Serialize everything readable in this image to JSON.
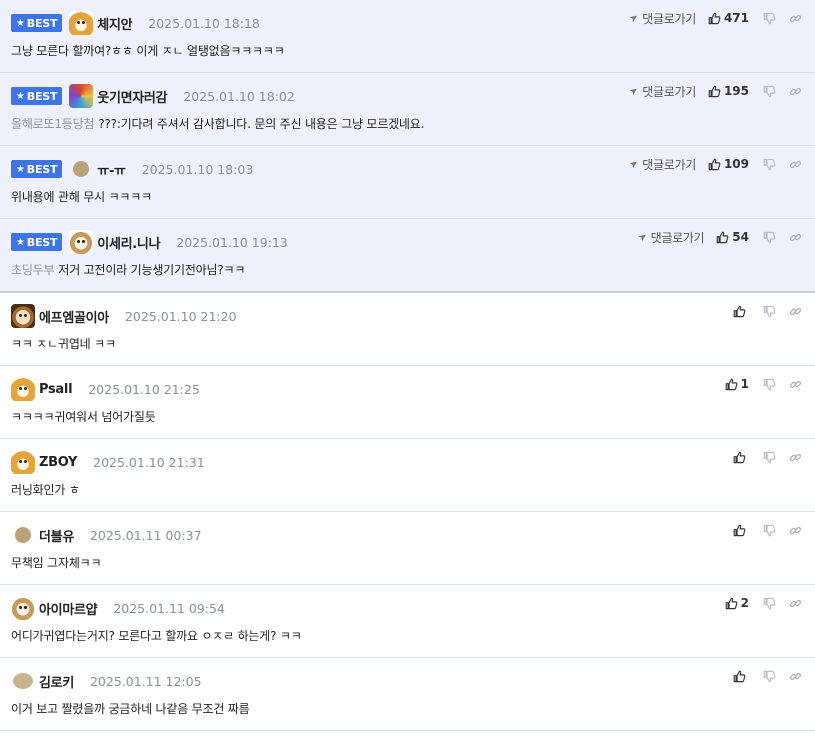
{
  "reply_label": "댓글로가기",
  "best_label": "BEST",
  "comments": [
    {
      "best": true,
      "avatar": "fox",
      "nick": "체지안",
      "date": "2025.01.10 18:18",
      "mention": "",
      "text": "그냥 모른다 할까여?ㅎㅎ 이게 ㅈㄴ 얼탱없음ㅋㅋㅋㅋㅋ",
      "likes": "471"
    },
    {
      "best": true,
      "avatar": "color",
      "nick": "웃기면자러감",
      "date": "2025.01.10 18:02",
      "mention": "올해로또1등당첨",
      "text": "???:기다려 주셔서 감사합니다. 문의 주신 내용은 그냥 모르겠네요.",
      "likes": "195"
    },
    {
      "best": true,
      "avatar": "dot",
      "nick": "ㅠ-ㅠ",
      "date": "2025.01.10 18:03",
      "mention": "",
      "text": "위내용에 관해 무시 ㅋㅋㅋㅋ",
      "likes": "109"
    },
    {
      "best": true,
      "avatar": "pup",
      "nick": "이세리.니나",
      "date": "2025.01.10 19:13",
      "mention": "초딩두부",
      "text": "저거 고전이라 기능생기기전아님?ㅋㅋ",
      "likes": "54"
    },
    {
      "best": false,
      "avatar": "dog",
      "nick": "에프엠골이아",
      "date": "2025.01.10 21:20",
      "mention": "",
      "text": "ㅋㅋ ㅈㄴ귀엽네 ㅋㅋ",
      "likes": ""
    },
    {
      "best": false,
      "avatar": "fox",
      "nick": "Psall",
      "date": "2025.01.10 21:25",
      "mention": "",
      "text": "ㅋㅋㅋㅋ귀여워서 넘어가질듯",
      "likes": "1"
    },
    {
      "best": false,
      "avatar": "fox",
      "nick": "ZBOY",
      "date": "2025.01.10 21:31",
      "mention": "",
      "text": "러닝화인가 ㅎ",
      "likes": ""
    },
    {
      "best": false,
      "avatar": "dot",
      "nick": "더블유",
      "date": "2025.01.11 00:37",
      "mention": "",
      "text": "무책임 그자체ㅋㅋ",
      "likes": ""
    },
    {
      "best": false,
      "avatar": "pup",
      "nick": "아이마르얍",
      "date": "2025.01.11 09:54",
      "mention": "",
      "text": "어디가귀엽다는거지? 모른다고 할까요 ㅇㅈㄹ 하는게? ㅋㅋ",
      "likes": "2"
    },
    {
      "best": false,
      "avatar": "blob",
      "nick": "김로키",
      "date": "2025.01.11 12:05",
      "mention": "",
      "text": "이거 보고 짤렸을까 궁금하네 나같음 무조건 짜름",
      "likes": ""
    }
  ]
}
